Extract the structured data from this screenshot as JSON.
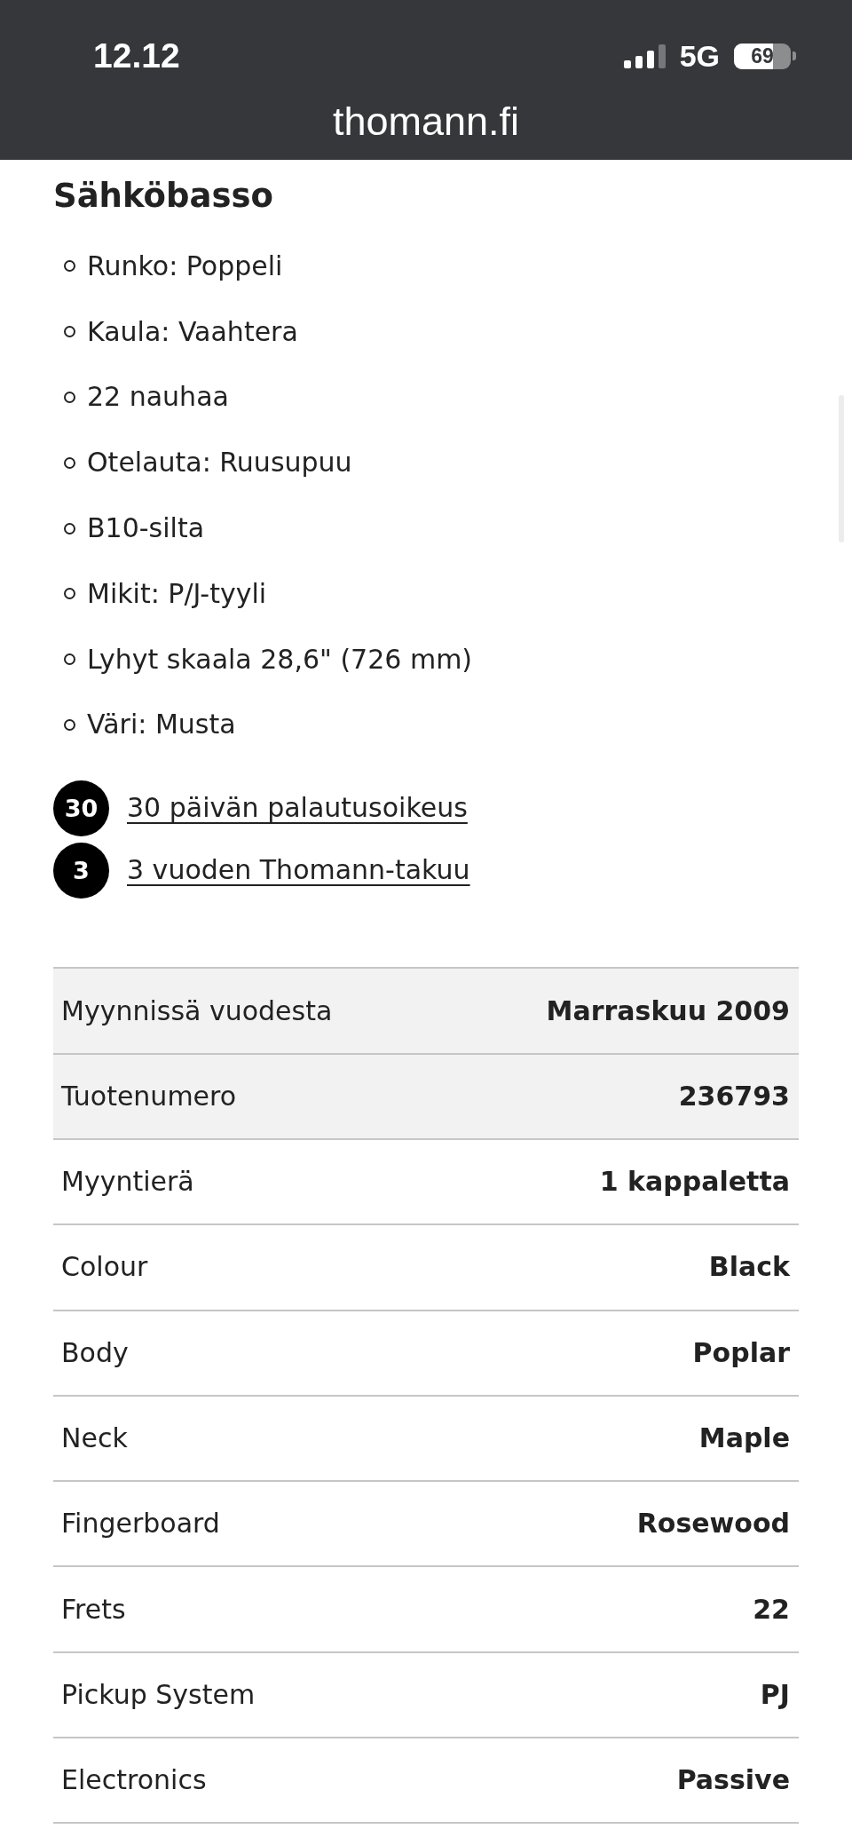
{
  "status_bar": {
    "time": "12.12",
    "network": "5G",
    "battery": "69"
  },
  "address_bar": {
    "url": "thomann.fi"
  },
  "features": {
    "title": "Sähköbasso",
    "items": [
      "Runko: Poppeli",
      "Kaula: Vaahtera",
      "22 nauhaa",
      "Otelauta: Ruusupuu",
      "B10-silta",
      "Mikit: P/J-tyyli",
      "Lyhyt skaala 28,6\" (726 mm)",
      "Väri: Musta"
    ]
  },
  "guarantees": [
    {
      "badge": "30",
      "label": "30 päivän palautusoikeus"
    },
    {
      "badge": "3",
      "label": "3 vuoden Thomann-takuu"
    }
  ],
  "specs": [
    {
      "label": "Myynnissä vuodesta",
      "value": "Marraskuu 2009",
      "shaded": true
    },
    {
      "label": "Tuotenumero",
      "value": "236793",
      "shaded": true
    },
    {
      "label": "Myyntierä",
      "value": "1 kappaletta",
      "shaded": false
    },
    {
      "label": "Colour",
      "value": "Black",
      "shaded": false
    },
    {
      "label": "Body",
      "value": "Poplar",
      "shaded": false
    },
    {
      "label": "Neck",
      "value": "Maple",
      "shaded": false
    },
    {
      "label": "Fingerboard",
      "value": "Rosewood",
      "shaded": false
    },
    {
      "label": "Frets",
      "value": "22",
      "shaded": false
    },
    {
      "label": "Pickup System",
      "value": "PJ",
      "shaded": false
    },
    {
      "label": "Electronics",
      "value": "Passive",
      "shaded": false
    }
  ]
}
